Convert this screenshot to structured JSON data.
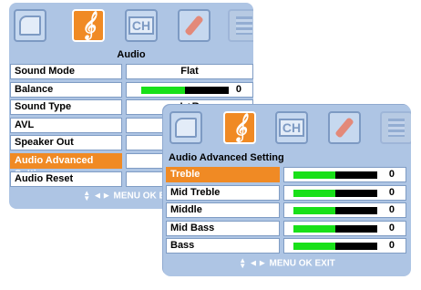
{
  "main_menu": {
    "tabs": [
      {
        "icon": "picture-icon",
        "active": false
      },
      {
        "icon": "music-note-icon",
        "active": true
      },
      {
        "icon": "channel-icon",
        "active": false
      },
      {
        "icon": "wrench-icon",
        "active": false
      },
      {
        "icon": "list-icon",
        "active": false
      }
    ],
    "title": "Audio",
    "rows": [
      {
        "label": "Sound Mode",
        "value": "Flat"
      },
      {
        "label": "Balance",
        "level": 0.5,
        "value": "0"
      },
      {
        "label": "Sound Type",
        "value": "L+R"
      },
      {
        "label": "AVL",
        "value": ""
      },
      {
        "label": "Speaker Out",
        "value": ""
      },
      {
        "label": "Audio Advanced Setting >",
        "value": "",
        "selected": true
      },
      {
        "label": "Audio Reset",
        "value": ""
      }
    ],
    "footer": "◄► MENU OK EXIT"
  },
  "sub_menu": {
    "tabs": [
      {
        "icon": "picture-icon",
        "active": false
      },
      {
        "icon": "music-note-icon",
        "active": true
      },
      {
        "icon": "channel-icon",
        "active": false
      },
      {
        "icon": "wrench-icon",
        "active": false
      },
      {
        "icon": "list-icon",
        "active": false
      }
    ],
    "title": "Audio Advanced Setting",
    "rows": [
      {
        "label": "Treble",
        "level": 0.5,
        "value": "0",
        "selected": true
      },
      {
        "label": "Mid Treble",
        "level": 0.5,
        "value": "0"
      },
      {
        "label": "Middle",
        "level": 0.5,
        "value": "0"
      },
      {
        "label": "Mid Bass",
        "level": 0.5,
        "value": "0"
      },
      {
        "label": "Bass",
        "level": 0.5,
        "value": "0"
      }
    ],
    "footer": "◄► MENU OK EXIT"
  },
  "colors": {
    "panel": "#aec5e4",
    "selected": "#f08a24",
    "bar_fill": "#19e019",
    "bar_track": "#000000"
  }
}
